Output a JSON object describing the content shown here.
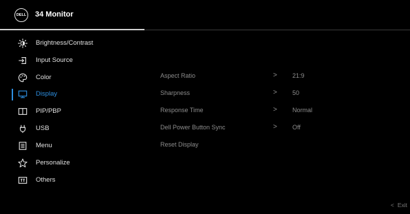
{
  "header": {
    "logo_text": "DELL",
    "title": "34 Monitor"
  },
  "sidebar": {
    "items": [
      {
        "label": "Brightness/Contrast",
        "icon": "brightness-icon"
      },
      {
        "label": "Input Source",
        "icon": "input-source-icon"
      },
      {
        "label": "Color",
        "icon": "color-palette-icon"
      },
      {
        "label": "Display",
        "icon": "display-monitor-icon",
        "active": true
      },
      {
        "label": "PIP/PBP",
        "icon": "pip-pbp-icon"
      },
      {
        "label": "USB",
        "icon": "usb-power-icon"
      },
      {
        "label": "Menu",
        "icon": "menu-icon"
      },
      {
        "label": "Personalize",
        "icon": "star-icon"
      },
      {
        "label": "Others",
        "icon": "others-icon"
      }
    ]
  },
  "display_settings": {
    "rows": [
      {
        "label": "Aspect Ratio",
        "chevron": ">",
        "value": "21:9"
      },
      {
        "label": "Sharpness",
        "chevron": ">",
        "value": "50"
      },
      {
        "label": "Response Time",
        "chevron": ">",
        "value": "Normal"
      },
      {
        "label": "Dell Power Button Sync",
        "chevron": ">",
        "value": "Off"
      },
      {
        "label": "Reset Display"
      }
    ]
  },
  "footer": {
    "exit_chevron": "<",
    "exit_label": "Exit"
  },
  "colors": {
    "accent": "#2e8fe0",
    "background": "#000000",
    "text_primary": "#e0e0e0",
    "text_secondary": "#8c8c8c"
  }
}
